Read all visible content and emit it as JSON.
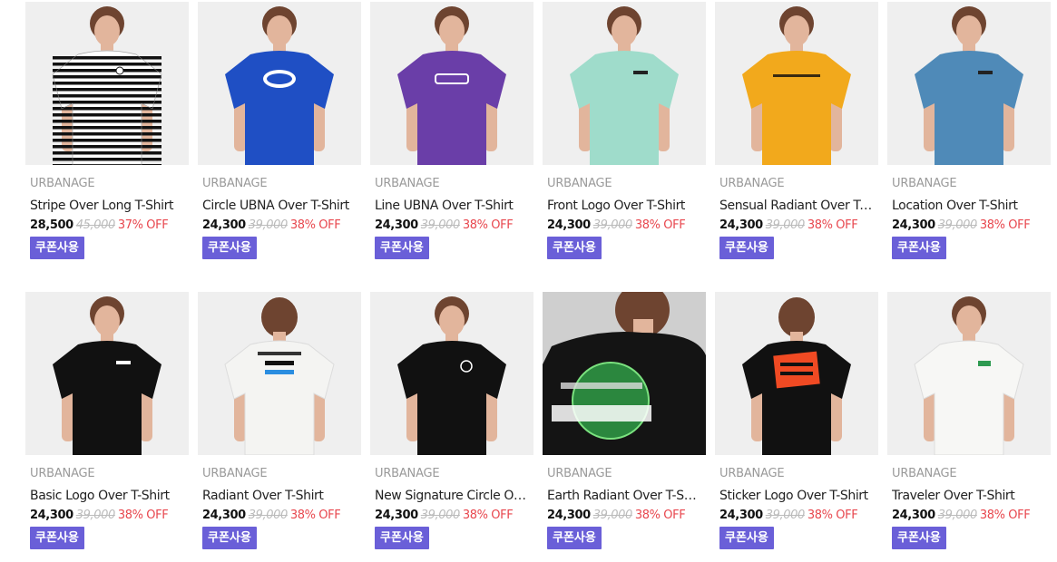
{
  "colors": {
    "accent": "#6a5fd8",
    "discount": "#e8474e",
    "muted": "#9a9a9a"
  },
  "products": [
    {
      "brand": "URBANAGE",
      "name": "Stripe Over Long T-Shirt",
      "price": "28,500",
      "original": "45,000",
      "discount": "37% OFF",
      "coupon": "쿠폰사용",
      "shirt_color": "#ffffff",
      "pattern": "stripe",
      "view": "front",
      "print": "dot"
    },
    {
      "brand": "URBANAGE",
      "name": "Circle UBNA Over T-Shirt",
      "price": "24,300",
      "original": "39,000",
      "discount": "38% OFF",
      "coupon": "쿠폰사용",
      "shirt_color": "#1f4fc4",
      "pattern": "solid",
      "view": "front",
      "print": "oval"
    },
    {
      "brand": "URBANAGE",
      "name": "Line UBNA Over T-Shirt",
      "price": "24,300",
      "original": "39,000",
      "discount": "38% OFF",
      "coupon": "쿠폰사용",
      "shirt_color": "#6a3ea8",
      "pattern": "solid",
      "view": "front",
      "print": "wordmark"
    },
    {
      "brand": "URBANAGE",
      "name": "Front Logo Over T-Shirt",
      "price": "24,300",
      "original": "39,000",
      "discount": "38% OFF",
      "coupon": "쿠폰사용",
      "shirt_color": "#9fdccb",
      "pattern": "solid",
      "view": "front",
      "print": "small"
    },
    {
      "brand": "URBANAGE",
      "name": "Sensual Radiant Over T-Shirt",
      "price": "24,300",
      "original": "39,000",
      "discount": "38% OFF",
      "coupon": "쿠폰사용",
      "shirt_color": "#f2a91c",
      "pattern": "solid",
      "view": "front",
      "print": "line"
    },
    {
      "brand": "URBANAGE",
      "name": "Location Over T-Shirt",
      "price": "24,300",
      "original": "39,000",
      "discount": "38% OFF",
      "coupon": "쿠폰사용",
      "shirt_color": "#4f8ab8",
      "pattern": "solid",
      "view": "front",
      "print": "small"
    },
    {
      "brand": "URBANAGE",
      "name": "Basic Logo Over T-Shirt",
      "price": "24,300",
      "original": "39,000",
      "discount": "38% OFF",
      "coupon": "쿠폰사용",
      "shirt_color": "#111111",
      "pattern": "solid",
      "view": "front",
      "print": "small"
    },
    {
      "brand": "URBANAGE",
      "name": "Radiant Over T-Shirt",
      "price": "24,300",
      "original": "39,000",
      "discount": "38% OFF",
      "coupon": "쿠폰사용",
      "shirt_color": "#f4f4f2",
      "pattern": "solid",
      "view": "back",
      "print": "back-text"
    },
    {
      "brand": "URBANAGE",
      "name": "New Signature Circle Over T-Shirt",
      "price": "24,300",
      "original": "39,000",
      "discount": "38% OFF",
      "coupon": "쿠폰사용",
      "shirt_color": "#111111",
      "pattern": "solid",
      "view": "front",
      "print": "circle"
    },
    {
      "brand": "URBANAGE",
      "name": "Earth Radiant Over T-Shirt",
      "price": "24,300",
      "original": "39,000",
      "discount": "38% OFF",
      "coupon": "쿠폰사용",
      "shirt_color": "#111111",
      "pattern": "solid",
      "view": "closeup",
      "print": "globe"
    },
    {
      "brand": "URBANAGE",
      "name": "Sticker Logo Over T-Shirt",
      "price": "24,300",
      "original": "39,000",
      "discount": "38% OFF",
      "coupon": "쿠폰사용",
      "shirt_color": "#111111",
      "pattern": "solid",
      "view": "back",
      "print": "sticker"
    },
    {
      "brand": "URBANAGE",
      "name": "Traveler Over T-Shirt",
      "price": "24,300",
      "original": "39,000",
      "discount": "38% OFF",
      "coupon": "쿠폰사용",
      "shirt_color": "#f7f7f5",
      "pattern": "solid",
      "view": "front",
      "print": "green-small"
    }
  ]
}
